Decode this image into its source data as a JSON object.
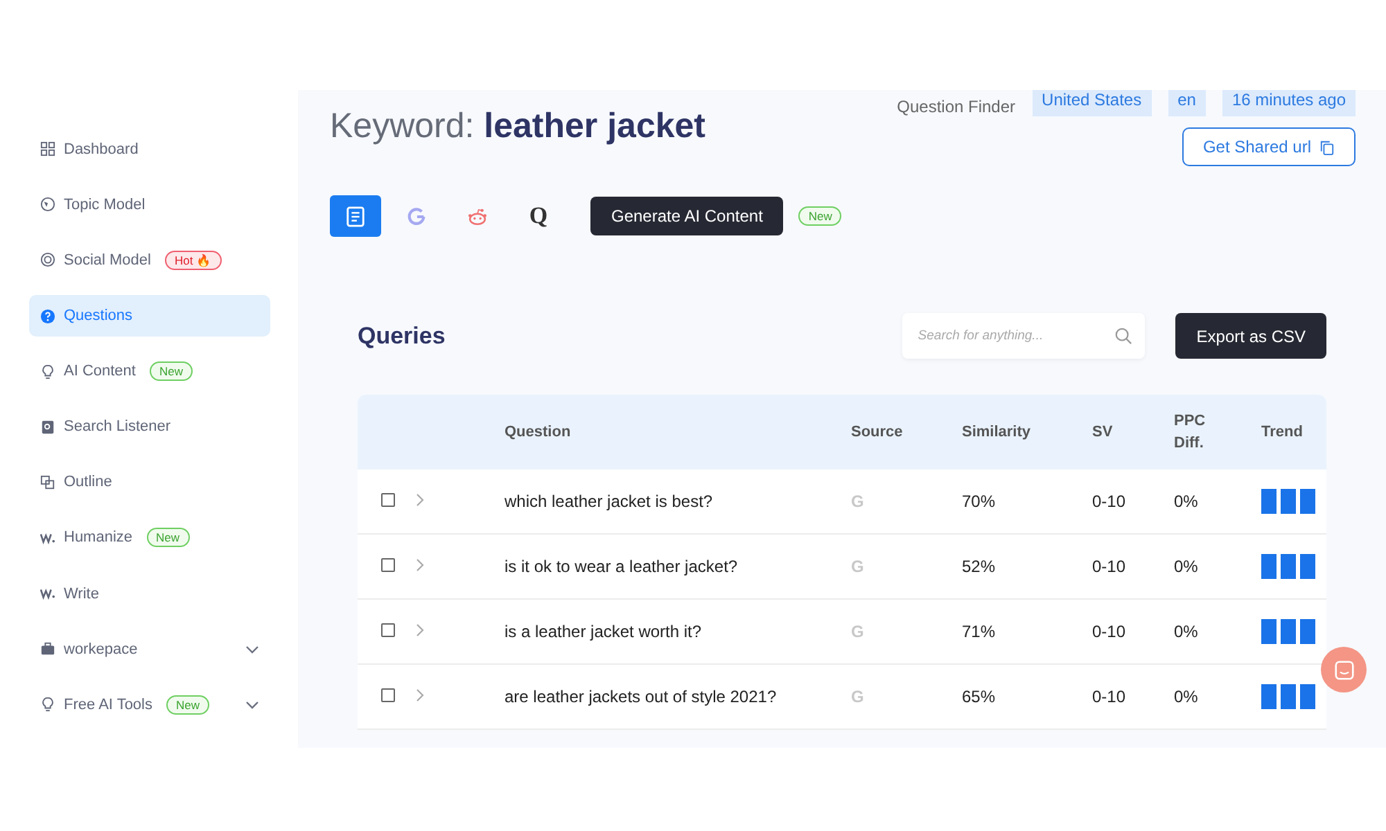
{
  "sidebar": {
    "items": [
      {
        "label": "Dashboard",
        "selected": false
      },
      {
        "label": "Topic Model",
        "selected": false
      },
      {
        "label": "Social Model",
        "selected": false,
        "badge": {
          "text": "Hot 🔥",
          "kind": "hot"
        }
      },
      {
        "label": "Questions",
        "selected": true
      },
      {
        "label": "AI Content",
        "selected": false,
        "badge": {
          "text": "New",
          "kind": "new"
        }
      },
      {
        "label": "Search Listener",
        "selected": false
      },
      {
        "label": "Outline",
        "selected": false
      },
      {
        "label": "Humanize",
        "selected": false,
        "badge": {
          "text": "New",
          "kind": "new"
        }
      },
      {
        "label": "Write",
        "selected": false
      },
      {
        "label": "workepace",
        "selected": false,
        "expandable": true
      },
      {
        "label": "Free AI Tools",
        "selected": false,
        "expandable": true,
        "badge": {
          "text": "New",
          "kind": "new"
        }
      }
    ]
  },
  "header": {
    "keyword_label": "Keyword:",
    "keyword": "leather jacket",
    "tool": "Question Finder",
    "tags": [
      "United States",
      "en",
      "16 minutes ago"
    ],
    "share_button": "Get Shared url"
  },
  "source_tabs": [
    {
      "kind": "doc",
      "selected": true
    },
    {
      "kind": "google",
      "selected": false
    },
    {
      "kind": "reddit",
      "selected": false
    },
    {
      "kind": "quora",
      "selected": false,
      "text": "Q"
    }
  ],
  "generate_button": "Generate AI Content",
  "generate_badge": "New",
  "queries": {
    "title": "Queries",
    "search": {
      "placeholder": "Search for anything..."
    },
    "export_button": "Export as CSV",
    "columns": [
      "Question",
      "Source",
      "Similarity",
      "SV",
      "PPC Diff.",
      "Trend"
    ],
    "rows": [
      {
        "checked": false,
        "question": "which leather jacket is best?",
        "source": "G",
        "similarity": "70%",
        "sv": "0-10",
        "ppc": "0%"
      },
      {
        "checked": false,
        "question": "is it ok to wear a leather jacket?",
        "source": "G",
        "similarity": "52%",
        "sv": "0-10",
        "ppc": "0%"
      },
      {
        "checked": false,
        "question": "is a leather jacket worth it?",
        "source": "G",
        "similarity": "71%",
        "sv": "0-10",
        "ppc": "0%"
      },
      {
        "checked": false,
        "question": "are leather jackets out of style 2021?",
        "source": "G",
        "similarity": "65%",
        "sv": "0-10",
        "ppc": "0%"
      }
    ]
  }
}
